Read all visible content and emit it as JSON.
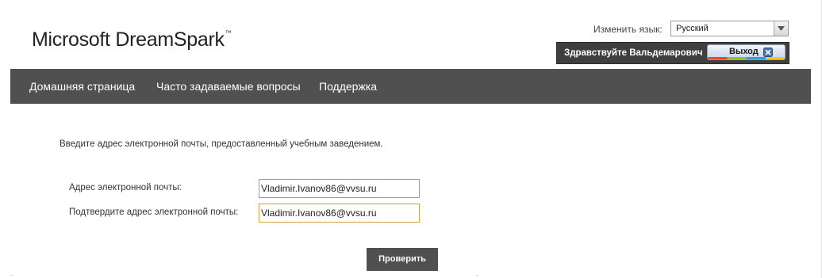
{
  "header": {
    "logo_text": "Microsoft DreamSpark",
    "logo_mark": "™",
    "language": {
      "label": "Изменить язык:",
      "selected": "Русский"
    },
    "greeting": "Здравствуйте Вальдемарович",
    "logout_label": "Выход"
  },
  "nav": {
    "items": [
      {
        "label": "Домашняя страница"
      },
      {
        "label": "Часто задаваемые вопросы"
      },
      {
        "label": "Поддержка"
      }
    ]
  },
  "form": {
    "instruction": "Введите адрес электронной почты, предоставленный учебным заведением.",
    "email_label": "Адрес электронной почты:",
    "email_value": "Vladimir.Ivanov86@vvsu.ru",
    "confirm_label": "Подтвердите адрес электронной почты:",
    "confirm_value": "Vladimir.Ivanov86@vvsu.ru",
    "submit_label": "Проверить"
  },
  "colors": {
    "navbar": "#505050",
    "focus_border": "#d1a84b"
  }
}
